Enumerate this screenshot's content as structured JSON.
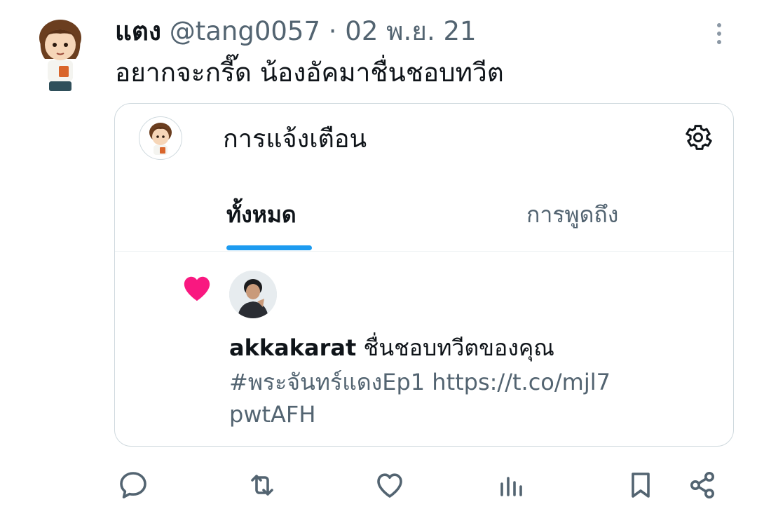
{
  "tweet": {
    "display_name": "แตง",
    "handle": "@tang0057",
    "separator": "·",
    "date": "02 พ.ย. 21",
    "text": "อยากจะกรี๊ด น้องอัคมาชื่นชอบทวีต"
  },
  "embedded": {
    "title": "การแจ้งเตือน",
    "tabs": [
      {
        "label": "ทั้งหมด",
        "active": true
      },
      {
        "label": "การพูดถึง",
        "active": false
      }
    ],
    "notification": {
      "user": "akkakarat",
      "text": "ชื่นชอบทวีตของคุณ",
      "link": "#พระจันทร์แดงEp1 https://t.co/mjl7pwtAFH"
    }
  },
  "actions": [
    {
      "icon": "reply-icon"
    },
    {
      "icon": "retweet-icon"
    },
    {
      "icon": "like-icon"
    },
    {
      "icon": "analytics-icon"
    },
    {
      "icon": "bookmark-icon"
    },
    {
      "icon": "share-icon"
    }
  ],
  "colors": {
    "accent": "#1d9bf0",
    "heart": "#f91880",
    "muted": "#536471",
    "border": "#cfd9de"
  }
}
